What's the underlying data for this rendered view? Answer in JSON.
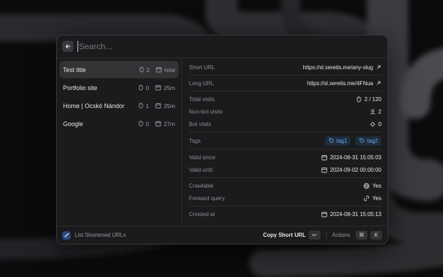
{
  "search": {
    "placeholder": "Search..."
  },
  "list": [
    {
      "title": "Test title",
      "visits": "2",
      "age": "now",
      "selected": true
    },
    {
      "title": "Portfolio site",
      "visits": "0",
      "age": "25m"
    },
    {
      "title": "Home | Ocskó Nándor",
      "visits": "1",
      "age": "25m"
    },
    {
      "title": "Google",
      "visits": "0",
      "age": "27m"
    }
  ],
  "detail": {
    "short_url": {
      "label": "Short URL",
      "value": "https://sl.xeretis.me/any-slug"
    },
    "long_url": {
      "label": "Long URL",
      "value": "https://sl.xeretis.me/4FNua"
    },
    "total_visits": {
      "label": "Total visits",
      "value": "2 / 120"
    },
    "non_bot_visits": {
      "label": "Non-bot visits",
      "value": "2"
    },
    "bot_visits": {
      "label": "Bot visits",
      "value": "0"
    },
    "tags": {
      "label": "Tags",
      "items": [
        "tag1",
        "tag2"
      ]
    },
    "valid_since": {
      "label": "Valid since",
      "value": "2024-08-31 15:05:03"
    },
    "valid_until": {
      "label": "Valid until",
      "value": "2024-09-02 00:00:00"
    },
    "crawlable": {
      "label": "Crawlable",
      "value": "Yes"
    },
    "forward_query": {
      "label": "Forward query",
      "value": "Yes"
    },
    "created_at": {
      "label": "Created at",
      "value": "2024-08-31 15:05:13"
    }
  },
  "footer": {
    "title": "List Shortened URLs",
    "primary_action": "Copy Short URL",
    "primary_key": "↩",
    "actions_label": "Actions",
    "key_cmd": "⌘",
    "key_k": "K"
  },
  "colors": {
    "tag_text": "#68a7e8",
    "tag_bg": "#1f2d3d",
    "selected_bg": "#333336"
  }
}
